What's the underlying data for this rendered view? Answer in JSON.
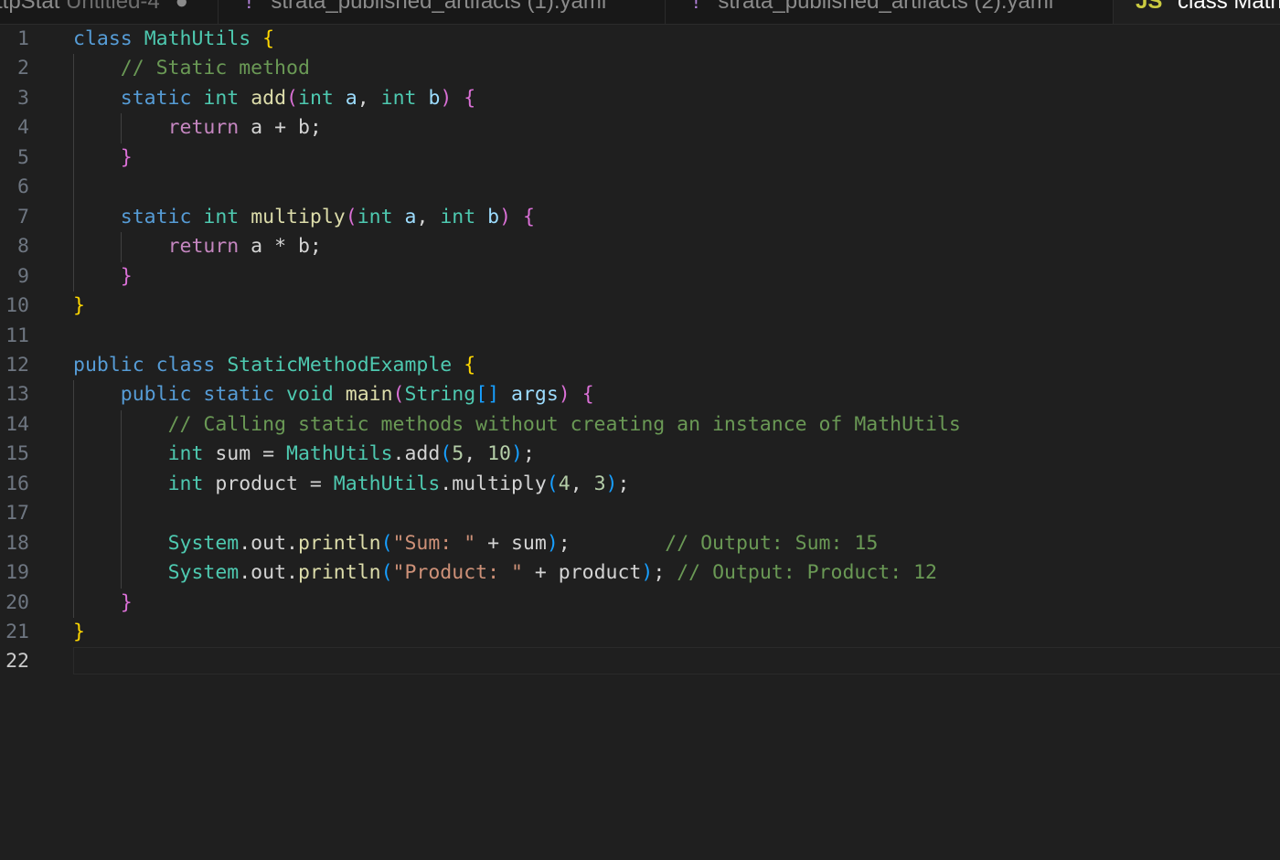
{
  "tabs": [
    {
      "name": "ttpStat",
      "suffix": "Untitled-4",
      "close": "●"
    },
    {
      "name": "strata_published_artifacts (1).yaml",
      "icon": "!"
    },
    {
      "name": "strata_published_artifacts (2).yaml",
      "icon": "!"
    },
    {
      "name": "class MathUtils",
      "icon": "JS",
      "active": true
    }
  ],
  "editor": {
    "current_line": 22,
    "line_numbers": [
      "1",
      "2",
      "3",
      "4",
      "5",
      "6",
      "7",
      "8",
      "9",
      "10",
      "11",
      "12",
      "13",
      "14",
      "15",
      "16",
      "17",
      "18",
      "19",
      "20",
      "21",
      "22"
    ],
    "lines": [
      [
        [
          "class",
          "kw"
        ],
        [
          " ",
          "p"
        ],
        [
          "MathUtils",
          "ty"
        ],
        [
          " ",
          "p"
        ],
        [
          "{",
          "b1"
        ]
      ],
      [
        [
          "    ",
          "p"
        ],
        [
          "// Static method",
          "cm"
        ]
      ],
      [
        [
          "    ",
          "p"
        ],
        [
          "static",
          "kw"
        ],
        [
          " ",
          "p"
        ],
        [
          "int",
          "ty"
        ],
        [
          " ",
          "p"
        ],
        [
          "add",
          "fn"
        ],
        [
          "(",
          "b2"
        ],
        [
          "int",
          "ty"
        ],
        [
          " ",
          "p"
        ],
        [
          "a",
          "var"
        ],
        [
          ", ",
          "p"
        ],
        [
          "int",
          "ty"
        ],
        [
          " ",
          "p"
        ],
        [
          "b",
          "var"
        ],
        [
          ")",
          "b2"
        ],
        [
          " ",
          "p"
        ],
        [
          "{",
          "b2"
        ]
      ],
      [
        [
          "        ",
          "p"
        ],
        [
          "return",
          "ctl"
        ],
        [
          " a + b;",
          "p"
        ]
      ],
      [
        [
          "    ",
          "p"
        ],
        [
          "}",
          "b2"
        ]
      ],
      [],
      [
        [
          "    ",
          "p"
        ],
        [
          "static",
          "kw"
        ],
        [
          " ",
          "p"
        ],
        [
          "int",
          "ty"
        ],
        [
          " ",
          "p"
        ],
        [
          "multiply",
          "fn"
        ],
        [
          "(",
          "b2"
        ],
        [
          "int",
          "ty"
        ],
        [
          " ",
          "p"
        ],
        [
          "a",
          "var"
        ],
        [
          ", ",
          "p"
        ],
        [
          "int",
          "ty"
        ],
        [
          " ",
          "p"
        ],
        [
          "b",
          "var"
        ],
        [
          ")",
          "b2"
        ],
        [
          " ",
          "p"
        ],
        [
          "{",
          "b2"
        ]
      ],
      [
        [
          "        ",
          "p"
        ],
        [
          "return",
          "ctl"
        ],
        [
          " a * b;",
          "p"
        ]
      ],
      [
        [
          "    ",
          "p"
        ],
        [
          "}",
          "b2"
        ]
      ],
      [
        [
          "}",
          "b1"
        ]
      ],
      [],
      [
        [
          "public",
          "kw"
        ],
        [
          " ",
          "p"
        ],
        [
          "class",
          "kw"
        ],
        [
          " ",
          "p"
        ],
        [
          "StaticMethodExample",
          "ty"
        ],
        [
          " ",
          "p"
        ],
        [
          "{",
          "b1"
        ]
      ],
      [
        [
          "    ",
          "p"
        ],
        [
          "public",
          "kw"
        ],
        [
          " ",
          "p"
        ],
        [
          "static",
          "kw"
        ],
        [
          " ",
          "p"
        ],
        [
          "void",
          "ty"
        ],
        [
          " ",
          "p"
        ],
        [
          "main",
          "fn"
        ],
        [
          "(",
          "b2"
        ],
        [
          "String",
          "ty"
        ],
        [
          "[]",
          "b3"
        ],
        [
          " ",
          "p"
        ],
        [
          "args",
          "var"
        ],
        [
          ")",
          "b2"
        ],
        [
          " ",
          "p"
        ],
        [
          "{",
          "b2"
        ]
      ],
      [
        [
          "        ",
          "p"
        ],
        [
          "// Calling static methods without creating an instance of MathUtils",
          "cm"
        ]
      ],
      [
        [
          "        ",
          "p"
        ],
        [
          "int",
          "ty"
        ],
        [
          " sum = ",
          "p"
        ],
        [
          "MathUtils",
          "ty"
        ],
        [
          ".add",
          "p"
        ],
        [
          "(",
          "b3"
        ],
        [
          "5",
          "num"
        ],
        [
          ", ",
          "p"
        ],
        [
          "10",
          "num"
        ],
        [
          ")",
          "b3"
        ],
        [
          ";",
          "p"
        ]
      ],
      [
        [
          "        ",
          "p"
        ],
        [
          "int",
          "ty"
        ],
        [
          " product = ",
          "p"
        ],
        [
          "MathUtils",
          "ty"
        ],
        [
          ".multiply",
          "p"
        ],
        [
          "(",
          "b3"
        ],
        [
          "4",
          "num"
        ],
        [
          ", ",
          "p"
        ],
        [
          "3",
          "num"
        ],
        [
          ")",
          "b3"
        ],
        [
          ";",
          "p"
        ]
      ],
      [],
      [
        [
          "        ",
          "p"
        ],
        [
          "System",
          "ty"
        ],
        [
          ".out.",
          "p"
        ],
        [
          "println",
          "fn"
        ],
        [
          "(",
          "b3"
        ],
        [
          "\"Sum: \"",
          "str"
        ],
        [
          " + sum",
          "p"
        ],
        [
          ")",
          "b3"
        ],
        [
          ";",
          "p"
        ],
        [
          "        ",
          "p"
        ],
        [
          "// Output: Sum: 15",
          "cm"
        ]
      ],
      [
        [
          "        ",
          "p"
        ],
        [
          "System",
          "ty"
        ],
        [
          ".out.",
          "p"
        ],
        [
          "println",
          "fn"
        ],
        [
          "(",
          "b3"
        ],
        [
          "\"Product: \"",
          "str"
        ],
        [
          " + product",
          "p"
        ],
        [
          ")",
          "b3"
        ],
        [
          ";",
          "p"
        ],
        [
          " ",
          "p"
        ],
        [
          "// Output: Product: 12",
          "cm"
        ]
      ],
      [
        [
          "    ",
          "p"
        ],
        [
          "}",
          "b2"
        ]
      ],
      [
        [
          "}",
          "b1"
        ]
      ],
      []
    ]
  }
}
